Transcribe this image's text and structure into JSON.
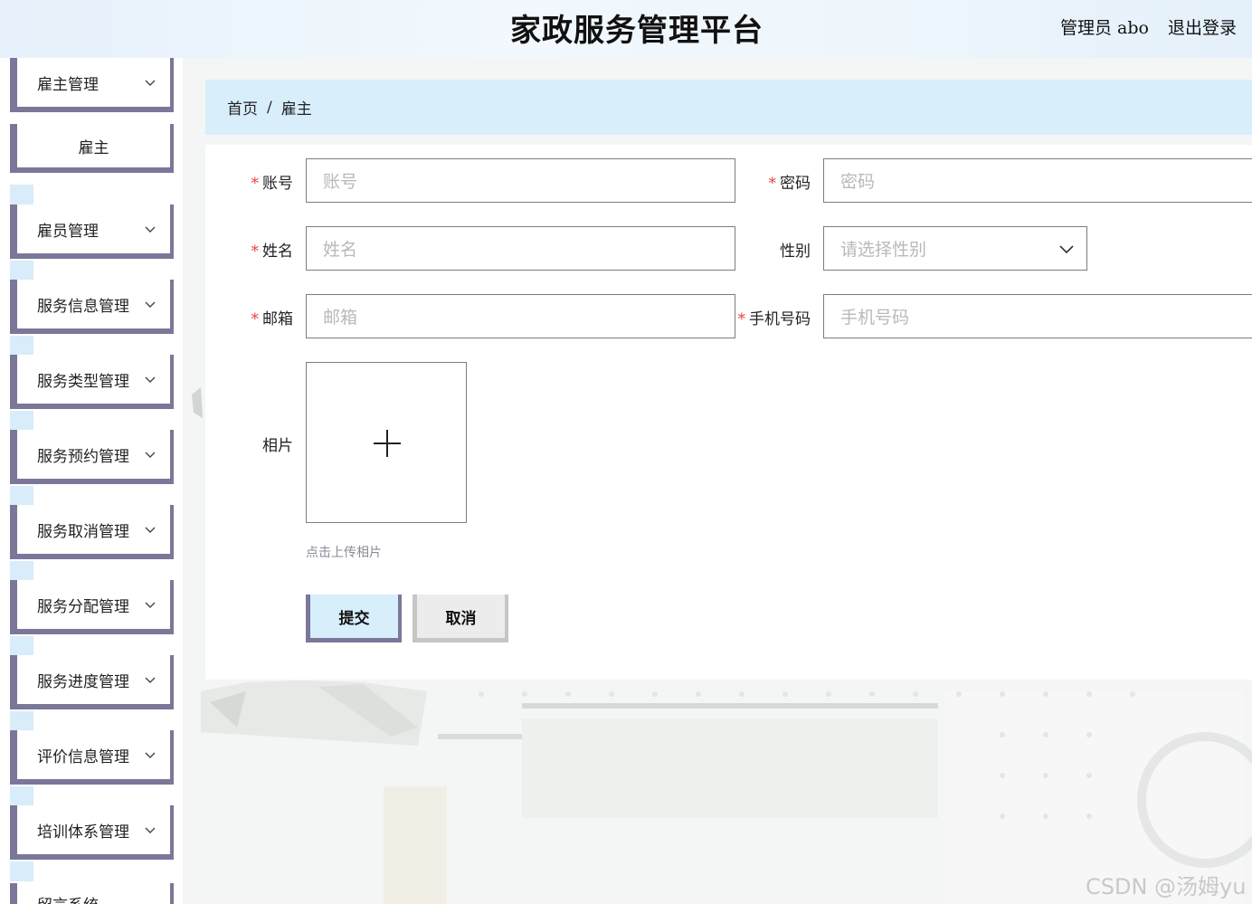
{
  "header": {
    "title": "家政服务管理平台",
    "user_label": "管理员 abo",
    "logout_label": "退出登录"
  },
  "sidebar": {
    "items": [
      {
        "label": "雇主管理"
      },
      {
        "label": "雇主"
      },
      {
        "label": "雇员管理"
      },
      {
        "label": "服务信息管理"
      },
      {
        "label": "服务类型管理"
      },
      {
        "label": "服务预约管理"
      },
      {
        "label": "服务取消管理"
      },
      {
        "label": "服务分配管理"
      },
      {
        "label": "服务进度管理"
      },
      {
        "label": "评价信息管理"
      },
      {
        "label": "培训体系管理"
      },
      {
        "label": "留言系统"
      }
    ]
  },
  "breadcrumb": {
    "home": "首页",
    "separator": "/",
    "current": "雇主"
  },
  "form": {
    "account": {
      "label": "账号",
      "placeholder": "账号"
    },
    "password": {
      "label": "密码",
      "placeholder": "密码"
    },
    "name": {
      "label": "姓名",
      "placeholder": "姓名"
    },
    "gender": {
      "label": "性别",
      "placeholder": "请选择性别"
    },
    "email": {
      "label": "邮箱",
      "placeholder": "邮箱"
    },
    "phone": {
      "label": "手机号码",
      "placeholder": "手机号码"
    },
    "photo": {
      "label": "相片",
      "hint": "点击上传相片",
      "icon": "plus-icon"
    },
    "required_mark": "*",
    "submit_label": "提交",
    "cancel_label": "取消"
  },
  "watermark": "CSDN @汤姆yu",
  "colors": {
    "accent_border": "#7b7799",
    "breadcrumb_bg": "#d9eefb",
    "required": "#e8453c"
  }
}
